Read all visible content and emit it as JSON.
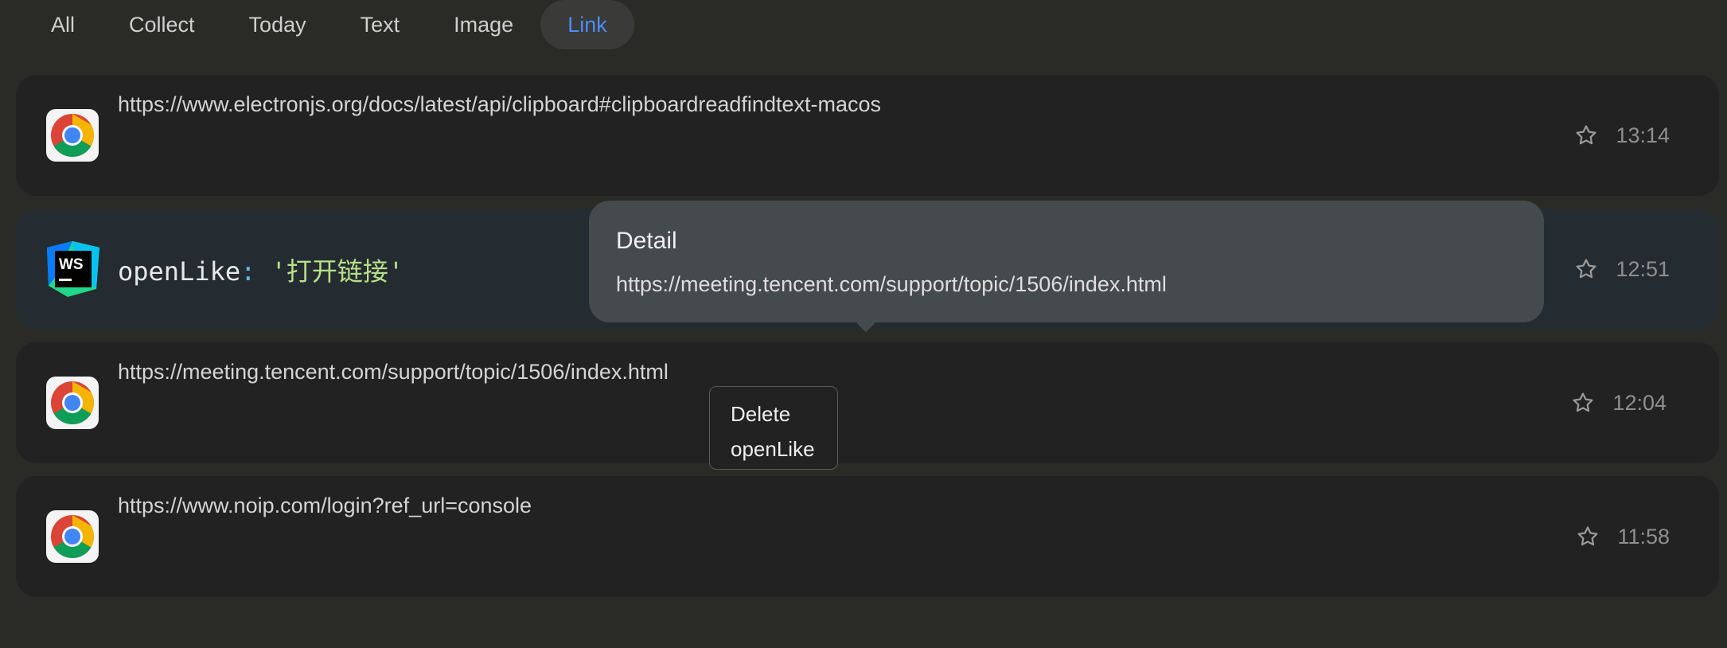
{
  "tabs": [
    {
      "label": "All",
      "active": false
    },
    {
      "label": "Collect",
      "active": false
    },
    {
      "label": "Today",
      "active": false
    },
    {
      "label": "Text",
      "active": false
    },
    {
      "label": "Image",
      "active": false
    },
    {
      "label": "Link",
      "active": true
    }
  ],
  "items": [
    {
      "app_icon": "chrome-icon",
      "text": "https://www.electronjs.org/docs/latest/api/clipboard#clipboardreadfindtext-macos",
      "time": "13:14"
    },
    {
      "app_icon": "webstorm-icon",
      "code_key": "openLike",
      "code_colon": ":",
      "code_value": "'打开链接'",
      "time": "12:51"
    },
    {
      "app_icon": "chrome-icon",
      "text": "https://meeting.tencent.com/support/topic/1506/index.html",
      "time": "12:04"
    },
    {
      "app_icon": "chrome-icon",
      "text": "https://www.noip.com/login?ref_url=console",
      "time": "11:58"
    }
  ],
  "tooltip": {
    "title": "Detail",
    "body": "https://meeting.tencent.com/support/topic/1506/index.html"
  },
  "context_menu": {
    "items": [
      "Delete",
      "openLike"
    ]
  },
  "colors": {
    "background": "#2a2a26",
    "card": "#222222",
    "card_selected": "#252c31",
    "accent": "#4d8cf5",
    "tooltip": "#454a4d"
  }
}
